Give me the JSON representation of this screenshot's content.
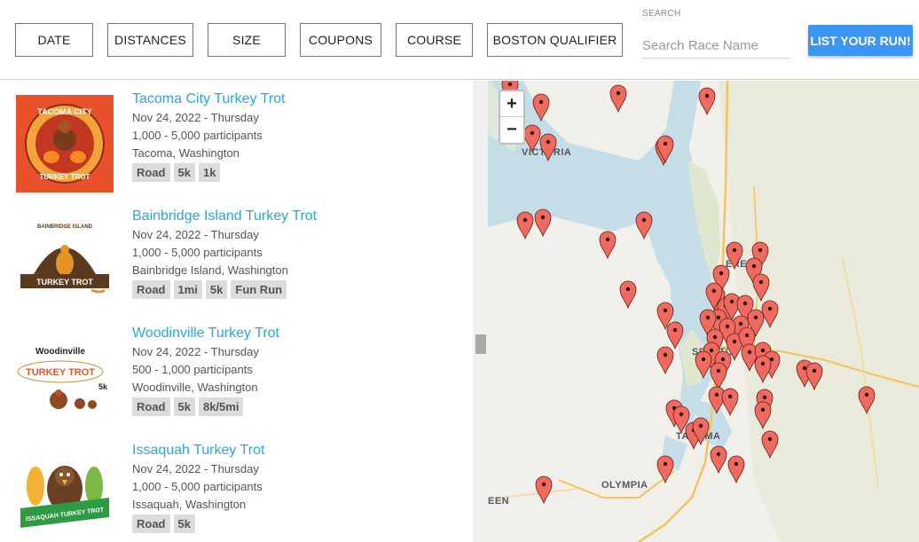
{
  "filters": {
    "date": "DATE",
    "distances": "DISTANCES",
    "size": "SIZE",
    "coupons": "COUPONS",
    "course": "COURSE",
    "boston": "BOSTON QUALIFIER"
  },
  "search": {
    "label": "SEARCH",
    "placeholder": "Search Race Name"
  },
  "list_button": "LIST YOUR RUN!",
  "races": [
    {
      "title": "Tacoma City Turkey Trot",
      "date": "Nov 24, 2022 - Thursday",
      "participants": "1,000 - 5,000 participants",
      "location": "Tacoma, Washington",
      "tags": [
        "Road",
        "5k",
        "1k"
      ]
    },
    {
      "title": "Bainbridge Island Turkey Trot",
      "date": "Nov 24, 2022 - Thursday",
      "participants": "1,000 - 5,000 participants",
      "location": "Bainbridge Island, Washington",
      "tags": [
        "Road",
        "1mi",
        "5k",
        "Fun Run"
      ]
    },
    {
      "title": "Woodinville Turkey Trot",
      "date": "Nov 24, 2022 - Thursday",
      "participants": "500 - 1,000 participants",
      "location": "Woodinville, Washington",
      "tags": [
        "Road",
        "5k",
        "8k/5mi"
      ]
    },
    {
      "title": "Issaquah Turkey Trot",
      "date": "Nov 24, 2022 - Thursday",
      "participants": "1,000 - 5,000 participants",
      "location": "Issaquah, Washington",
      "tags": [
        "Road",
        "5k"
      ]
    }
  ],
  "logos": {
    "tacoma_top": "TACOMA CITY",
    "tacoma_bottom": "TURKEY TROT",
    "bainbridge_top": "BAINBRIDGE ISLAND",
    "bainbridge_banner": "TURKEY TROT",
    "woodinville_top": "Woodinville",
    "woodinville_mid": "TURKEY TROT",
    "woodinville_5k": "5k",
    "issaquah_banner": "ISSAQUAH TURKEY TROT"
  },
  "map": {
    "zoom_in": "+",
    "zoom_out": "−",
    "labels": {
      "victoria": "VICTORIA",
      "seattle": "SEATTLE",
      "tacoma": "TACOMA",
      "olympia": "OLYMPIA",
      "everett": "ERE",
      "edge": "EEN"
    },
    "colors": {
      "water": "#c5dde6",
      "land": "#f1efe9",
      "pin": "#f06a5f",
      "road": "#f5c35a"
    }
  }
}
